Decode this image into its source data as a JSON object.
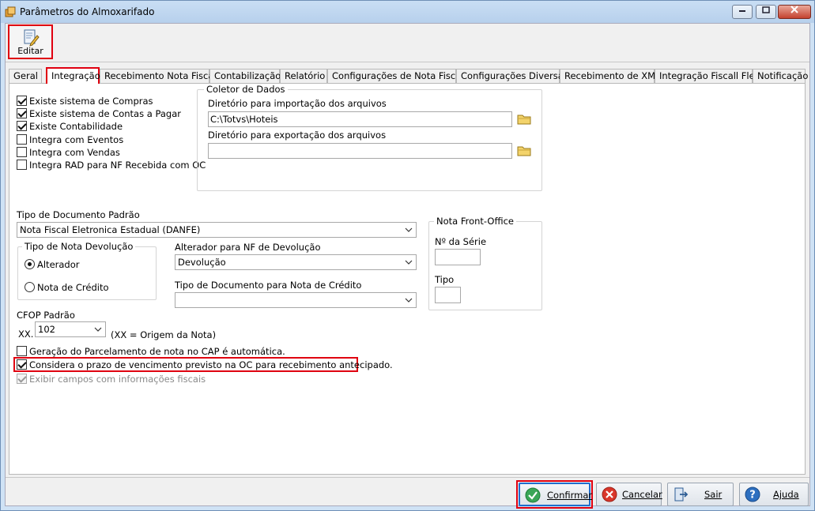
{
  "window": {
    "title": "Parâmetros do Almoxarifado",
    "controls": [
      "minimize",
      "maximize",
      "close"
    ]
  },
  "toolbar": {
    "edit_label": "Editar"
  },
  "tabs": [
    {
      "label": "Geral"
    },
    {
      "label": "Integração",
      "active": true
    },
    {
      "label": "Recebimento Nota Fiscal"
    },
    {
      "label": "Contabilização"
    },
    {
      "label": "Relatório"
    },
    {
      "label": "Configurações de Nota Fiscal"
    },
    {
      "label": "Configurações Diversas"
    },
    {
      "label": "Recebimento de XML"
    },
    {
      "label": "Integração Fiscall Flex"
    },
    {
      "label": "Notificação"
    }
  ],
  "integration": {
    "checkboxes": [
      {
        "label": "Existe sistema de Compras",
        "checked": true
      },
      {
        "label": "Existe sistema de Contas a Pagar",
        "checked": true
      },
      {
        "label": "Existe Contabilidade",
        "checked": true
      },
      {
        "label": "Integra com Eventos",
        "checked": false
      },
      {
        "label": "Integra com Vendas",
        "checked": false
      },
      {
        "label": "Integra RAD para NF Recebida com OC",
        "checked": false
      }
    ]
  },
  "collector": {
    "title": "Coletor de Dados",
    "import_label": "Diretório para importação dos arquivos",
    "import_value": "C:\\Totvs\\Hoteis",
    "export_label": "Diretório para exportação dos arquivos",
    "export_value": ""
  },
  "doc_type": {
    "label": "Tipo de Documento Padrão",
    "value": "Nota Fiscal Eletronica Estadual (DANFE)"
  },
  "return_note": {
    "title": "Tipo de Nota Devolução",
    "options": [
      {
        "label": "Alterador",
        "selected": true
      },
      {
        "label": "Nota de Crédito",
        "selected": false
      }
    ]
  },
  "return_alterer": {
    "label": "Alterador para NF de Devolução",
    "value": "Devolução"
  },
  "credit_doc_type": {
    "label": "Tipo de Documento para Nota de Crédito",
    "value": ""
  },
  "front_office": {
    "title": "Nota Front-Office",
    "series_label": "Nº da Série",
    "series_value": "",
    "type_label": "Tipo",
    "type_value": ""
  },
  "cfop": {
    "label": "CFOP Padrão",
    "prefix": "XX.",
    "value": "102",
    "hint": "(XX = Origem da Nota)"
  },
  "options": [
    {
      "label": "Geração do Parcelamento de nota no CAP é automática.",
      "checked": false,
      "enabled": true
    },
    {
      "label": "Considera o prazo de vencimento previsto na OC para recebimento antecipado.",
      "checked": true,
      "enabled": true
    },
    {
      "label": "Exibir campos com informações fiscais",
      "checked": true,
      "enabled": false
    }
  ],
  "buttons": {
    "confirm": "Confirmar",
    "cancel": "Cancelar",
    "exit": "Sair",
    "help": "Ajuda"
  },
  "colors": {
    "highlight": "#e00010",
    "titlebar": "#c9def4",
    "confirm_border": "#1e6fcf"
  }
}
